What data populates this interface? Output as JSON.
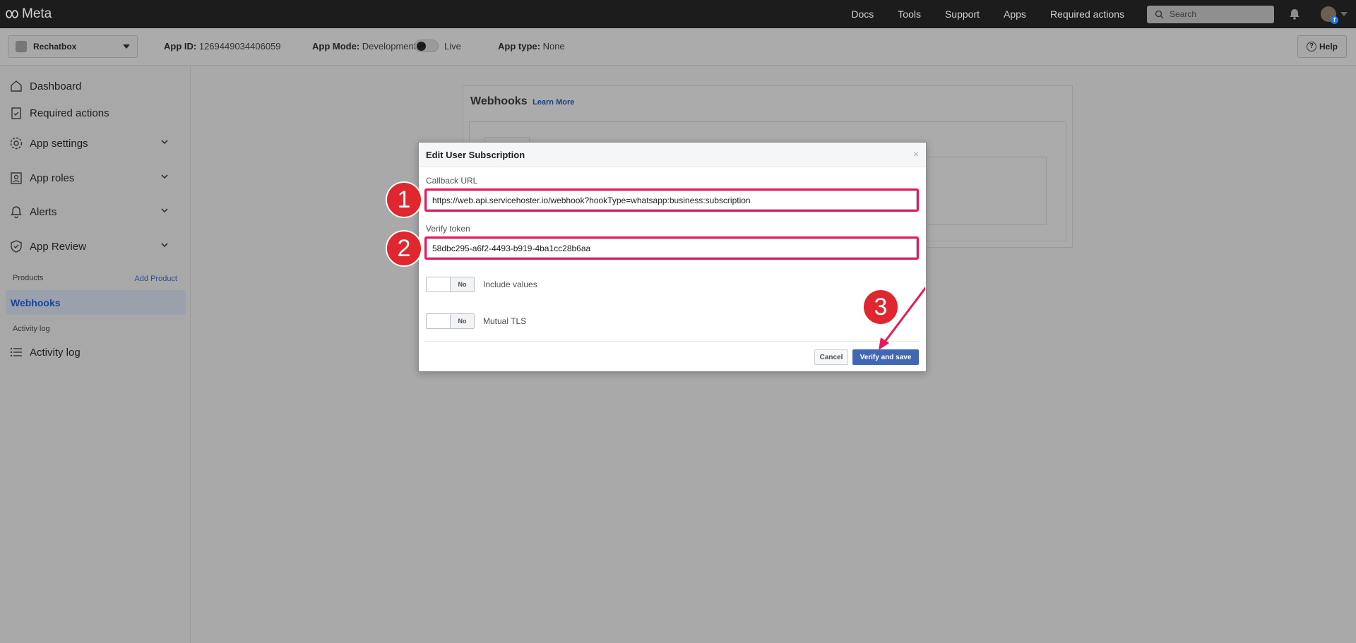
{
  "topnav": {
    "logo_text": "Meta",
    "links": [
      "Docs",
      "Tools",
      "Support",
      "Apps",
      "Required actions"
    ],
    "search_placeholder": "Search"
  },
  "subheader": {
    "app_name": "Rechatbox",
    "app_id_label": "App ID:",
    "app_id_value": "1269449034406059",
    "app_mode_label": "App Mode:",
    "app_mode_value": "Development",
    "live_label": "Live",
    "app_type_label": "App type:",
    "app_type_value": "None",
    "help_label": "Help"
  },
  "sidebar": {
    "items": [
      {
        "label": "Dashboard",
        "icon": "home-icon"
      },
      {
        "label": "Required actions",
        "icon": "clipboard-check-icon"
      },
      {
        "label": "App settings",
        "icon": "gear-icon"
      },
      {
        "label": "App roles",
        "icon": "user-badge-icon"
      },
      {
        "label": "Alerts",
        "icon": "bell-icon"
      },
      {
        "label": "App Review",
        "icon": "shield-check-icon"
      }
    ],
    "products_label": "Products",
    "add_product_label": "Add Product",
    "active_item": "Webhooks",
    "activity_section_label": "Activity log",
    "activity_item": "Activity log"
  },
  "background_card": {
    "title": "Webhooks",
    "learn_more": "Learn More"
  },
  "modal": {
    "title": "Edit User Subscription",
    "close": "×",
    "callback_label": "Callback URL",
    "callback_value": "https://web.api.servicehoster.io/webhook?hookType=whatsapp:business:subscription",
    "verify_label": "Verify token",
    "verify_value": "58dbc295-a6f2-4493-b919-4ba1cc28b6aa",
    "include_values_label": "Include values",
    "include_values_state": "No",
    "mutual_tls_label": "Mutual TLS",
    "mutual_tls_state": "No",
    "cancel_label": "Cancel",
    "verify_save_label": "Verify and save"
  },
  "annotations": {
    "step1": "1",
    "step2": "2",
    "step3": "3",
    "highlight_color": "#e8185a",
    "badge_color": "#e0262e"
  }
}
